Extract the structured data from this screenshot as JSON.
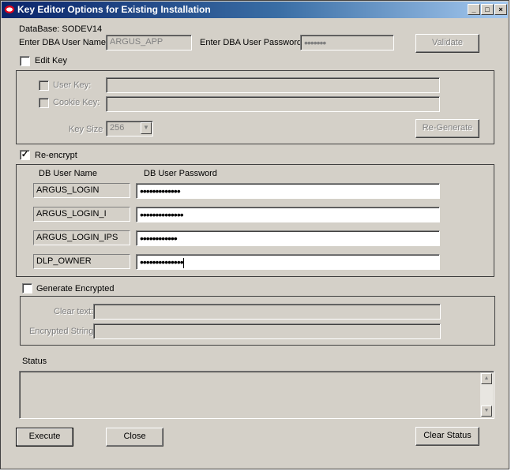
{
  "window": {
    "title": "Key Editor Options for Existing Installation",
    "controls": {
      "minimize": "_",
      "restore": "□",
      "close": "×"
    }
  },
  "db": {
    "database_label": "DataBase: SODEV14",
    "dba_user_label": "Enter DBA User Name:",
    "dba_user_value": "ARGUS_APP",
    "dba_password_label": "Enter DBA User Password:",
    "dba_password_value": "•••••••",
    "validate_label": "Validate"
  },
  "edit_key": {
    "checkbox_label": "Edit Key",
    "checked": false,
    "user_key_label": "User Key:",
    "cookie_key_label": "Cookie Key:",
    "key_size_label": "Key Size",
    "key_size_value": "256",
    "regenerate_label": "Re-Generate"
  },
  "reencrypt": {
    "checkbox_label": "Re-encrypt",
    "checked": true,
    "col_user": "DB User Name",
    "col_password": "DB User Password",
    "rows": [
      {
        "user": "ARGUS_LOGIN",
        "password": "•••••••••••••"
      },
      {
        "user": "ARGUS_LOGIN_I",
        "password": "••••••••••••••"
      },
      {
        "user": "ARGUS_LOGIN_IPS",
        "password": "••••••••••••"
      },
      {
        "user": "DLP_OWNER",
        "password": "••••••••••••••"
      }
    ]
  },
  "generate": {
    "checkbox_label": "Generate Encrypted",
    "checked": false,
    "clear_text_label": "Clear text:",
    "encrypted_label": "Encrypted String:"
  },
  "status": {
    "label": "Status",
    "text": ""
  },
  "actions": {
    "execute": "Execute",
    "close": "Close",
    "clear_status": "Clear Status"
  },
  "colors": {
    "dialog_bg": "#d4d0c8",
    "titlebar_start": "#0a246a",
    "titlebar_end": "#a6caf0",
    "logo_red": "#e0001b"
  }
}
